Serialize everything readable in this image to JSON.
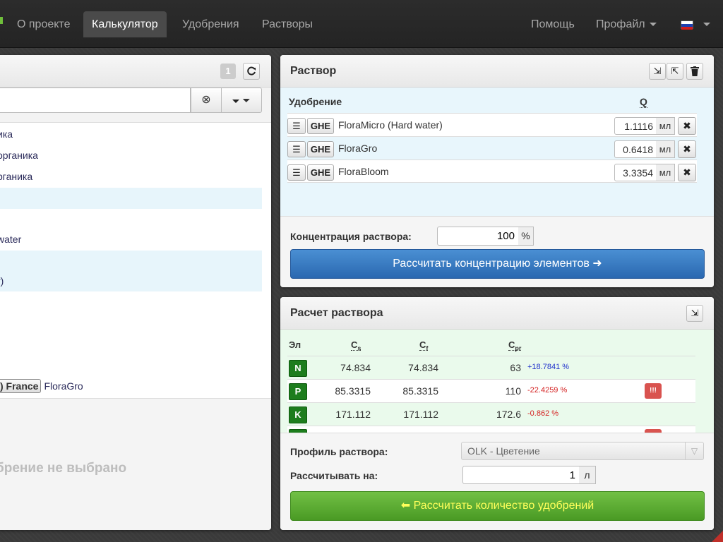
{
  "nav": {
    "items": [
      "О проекте",
      "Калькулятор",
      "Удобрения",
      "Растворы"
    ],
    "active": "Калькулятор",
    "help": "Помощь",
    "profile": "Профайл"
  },
  "left": {
    "badge": "1",
    "search_value": "",
    "rows": [
      "ика",
      "органика",
      "рганика",
      "",
      "",
      "water",
      "",
      "r)",
      ")",
      "",
      "",
      "",
      ""
    ],
    "tag_row": {
      "tag": ") France",
      "name": "FloraGro"
    },
    "empty_text": "брение не выбрано"
  },
  "solution": {
    "title": "Раствор",
    "col_fertilizer": "Удобрение",
    "col_q": "Q",
    "fertilizers": [
      {
        "brand": "GHE",
        "name": "FloraMicro (Hard water)",
        "amount": "1.1116",
        "unit": "мл"
      },
      {
        "brand": "GHE",
        "name": "FloraGro",
        "amount": "0.6418",
        "unit": "мл"
      },
      {
        "brand": "GHE",
        "name": "FloraBloom",
        "amount": "3.3354",
        "unit": "мл"
      }
    ],
    "concentration_label": "Концентрация раствора:",
    "concentration_value": "100",
    "concentration_unit": "%",
    "calc_button": "Рассчитать концентрацию элементов ➜"
  },
  "calc": {
    "title": "Расчет раствора",
    "headers": {
      "el": "Эл",
      "cs": "C",
      "cs_sub": "s",
      "cf": "C",
      "cf_sub": "f",
      "cpr": "C",
      "cpr_sub": "pr"
    },
    "rows": [
      {
        "el": "N",
        "cs": "74.834",
        "cf": "74.834",
        "cpr": "63",
        "pct": "+18.7841 %",
        "sign": "pos",
        "warn": ""
      },
      {
        "el": "P",
        "cs": "85.3315",
        "cf": "85.3315",
        "cpr": "110",
        "pct": "-22.4259 %",
        "sign": "neg",
        "warn": "!!!"
      },
      {
        "el": "K",
        "cs": "171.112",
        "cf": "171.112",
        "cpr": "172.6",
        "pct": "-0.862 %",
        "sign": "neg",
        "warn": ""
      }
    ],
    "profile_label": "Профиль раствора:",
    "profile_value": "OLK - Цветение",
    "liters_label": "Рассчитывать на:",
    "liters_value": "1",
    "liters_unit": "л",
    "calc_button": "⬅ Рассчитать количество удобрений"
  },
  "colors": {
    "accent_blue": "#2a68b0",
    "accent_green": "#4a9a24",
    "element_green": "#1d7d1d",
    "warn_red": "#d9534f"
  }
}
